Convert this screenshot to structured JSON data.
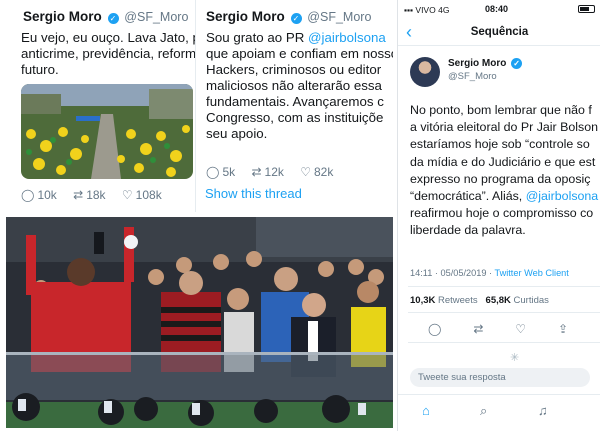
{
  "tweet1": {
    "name": "Sergio Moro",
    "handle": "@SF_Moro",
    "lines": [
      "Eu vejo, eu ouço. Lava Jato, pr",
      "anticrime, previdência, reforma",
      "futuro."
    ],
    "replies": "10k",
    "retweets": "18k",
    "likes": "108k"
  },
  "tweet2": {
    "name": "Sergio Moro",
    "handle": "@SF_Moro",
    "line1_pre": "Sou grato ao PR ",
    "line1_mention": "@jairbolsona",
    "lines": [
      "que apoiam e confiam em nosso",
      "Hackers, criminosos ou editor",
      "maliciosos não alterarão essa",
      "fundamentais. Avançaremos c",
      "Congresso, com as instituiçõe",
      "seu apoio."
    ],
    "replies": "5k",
    "retweets": "12k",
    "likes": "82k",
    "show_thread": "Show this thread"
  },
  "phone": {
    "carrier": "VIVO",
    "network": "4G",
    "time": "08:40",
    "nav_title": "Sequência",
    "name": "Sergio Moro",
    "handle": "@SF_Moro",
    "lines": [
      "No ponto, bom lembrar que não f",
      "a vitória eleitoral do Pr Jair Bolson",
      "estaríamos hoje sob “controle so",
      "da mídia e do Judiciário e que est",
      "expresso no programa da oposiç",
      "“democrática”. Aliás, "
    ],
    "mention": "@jairbolsona",
    "lines2": [
      "reafirmou hoje o compromisso co",
      "liberdade da palavra."
    ],
    "timestamp": "14:11 · 05/05/2019 · ",
    "source": "Twitter Web Client",
    "retweets_count": "10,3K",
    "retweets_label": "Retweets",
    "likes_count": "65,8K",
    "likes_label": "Curtidas",
    "reply_placeholder": "Tweete sua resposta"
  },
  "colors": {
    "twitter_blue": "#1da1f2",
    "text_gray": "#657786",
    "jersey_red": "#c8262b"
  },
  "icons": [
    "reply-icon",
    "retweet-icon",
    "like-icon",
    "share-icon",
    "home-icon",
    "search-icon",
    "notifications-icon",
    "back-chevron-icon",
    "verified-icon"
  ]
}
